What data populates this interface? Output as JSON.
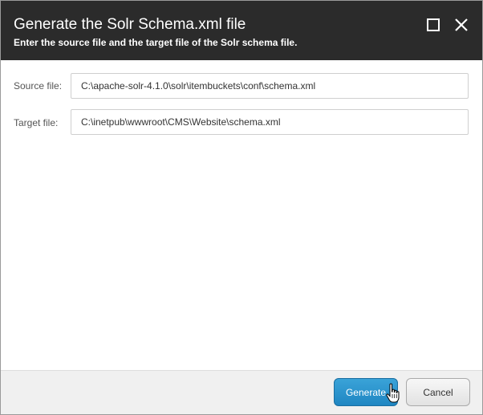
{
  "dialog": {
    "title": "Generate the Solr Schema.xml file",
    "subtitle": "Enter the source file and the target file of the Solr schema file.",
    "maximize_icon": "maximize-icon",
    "close_icon": "close-icon"
  },
  "form": {
    "source_label": "Source file:",
    "source_value": "C:\\apache-solr-4.1.0\\solr\\itembuckets\\conf\\schema.xml",
    "target_label": "Target file:",
    "target_value": "C:\\inetpub\\wwwroot\\CMS\\Website\\schema.xml"
  },
  "footer": {
    "generate_label": "Generate",
    "cancel_label": "Cancel"
  },
  "colors": {
    "header_bg": "#2b2b2b",
    "primary_button": "#2b93cd",
    "footer_bg": "#f0f0f0"
  },
  "cursor_icon": "hand-pointer-icon"
}
